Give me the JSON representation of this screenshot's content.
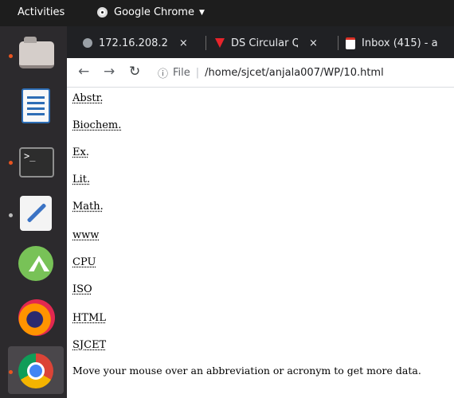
{
  "topbar": {
    "activities": "Activities",
    "app_name": "Google Chrome"
  },
  "dock": {
    "items": [
      {
        "name": "files",
        "running": true
      },
      {
        "name": "libreoffice-writer",
        "running": false
      },
      {
        "name": "terminal",
        "running": true,
        "label": ">_"
      },
      {
        "name": "text-editor",
        "running": true
      },
      {
        "name": "android-studio",
        "running": false
      },
      {
        "name": "firefox",
        "running": false
      },
      {
        "name": "chrome",
        "running": true
      }
    ]
  },
  "browser": {
    "tabs": [
      {
        "title": "172.16.208.2",
        "icon": "globe-icon"
      },
      {
        "title": "DS Circular Q",
        "icon": "vertabelo-icon",
        "icon_color": "#e8242b"
      },
      {
        "title": "Inbox (415) - a",
        "icon": "gmail-icon"
      }
    ],
    "close_glyph": "×",
    "address": {
      "security": "File",
      "path": "/home/sjcet/anjala007/WP/10.html"
    }
  },
  "page": {
    "abbreviations": [
      "Abstr.",
      "Biochem.",
      "Ex.",
      "Lit.",
      "Math.",
      "www",
      "CPU",
      "ISO",
      "HTML",
      "SJCET"
    ],
    "instruction": "Move your mouse over an abbreviation or acronym to get more data."
  },
  "colors": {
    "topbar": "#1d1d1d",
    "dock": "#2c2a2d",
    "tabstrip": "#202124",
    "running_indicator": "#e95420"
  }
}
